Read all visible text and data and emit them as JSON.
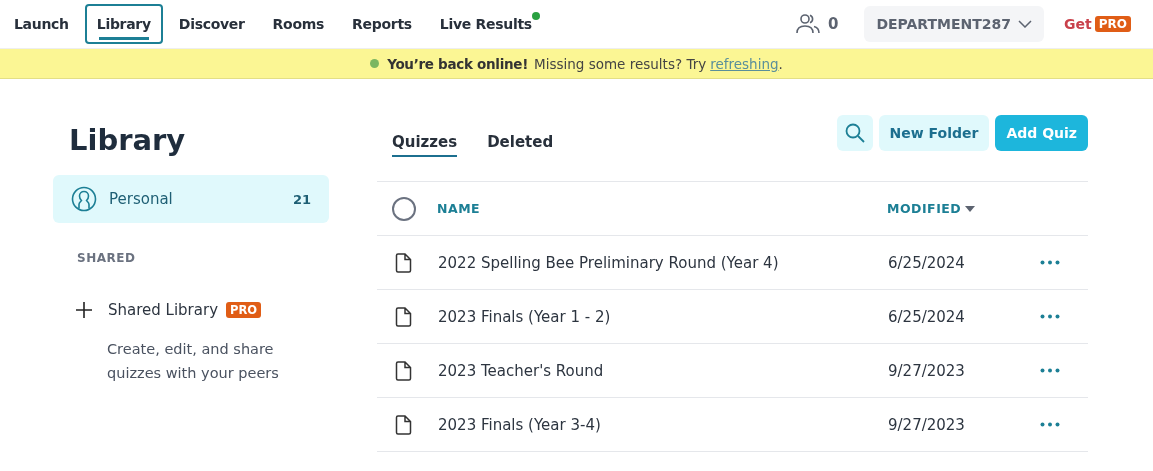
{
  "nav": {
    "items": [
      {
        "label": "Launch",
        "selected": false,
        "dot": false
      },
      {
        "label": "Library",
        "selected": true,
        "dot": false
      },
      {
        "label": "Discover",
        "selected": false,
        "dot": false
      },
      {
        "label": "Rooms",
        "selected": false,
        "dot": false
      },
      {
        "label": "Reports",
        "selected": false,
        "dot": false
      },
      {
        "label": "Live Results",
        "selected": false,
        "dot": true
      }
    ],
    "participants": "0",
    "account": "DEPARTMENT287",
    "get": "Get",
    "pro": "PRO"
  },
  "banner": {
    "bold": "You’re back online!",
    "text": "Missing some results? Try",
    "link": "refreshing",
    "end": "."
  },
  "sidebar": {
    "title": "Library",
    "personal": {
      "label": "Personal",
      "count": "21",
      "selected": true
    },
    "shared_heading": "SHARED",
    "shared_library": "Shared Library",
    "pro": "PRO",
    "description": "Create, edit, and share quizzes with your peers"
  },
  "tabs": [
    {
      "label": "Quizzes",
      "selected": true
    },
    {
      "label": "Deleted",
      "selected": false
    }
  ],
  "buttons": {
    "new_folder": "New Folder",
    "add_quiz": "Add Quiz"
  },
  "table": {
    "columns": {
      "name": "NAME",
      "modified": "MODIFIED"
    },
    "all_checked": false,
    "rows": [
      {
        "name": "2022 Spelling Bee Preliminary Round (Year 4)",
        "modified": "6/25/2024"
      },
      {
        "name": "2023 Finals (Year 1 - 2)",
        "modified": "6/25/2024"
      },
      {
        "name": "2023 Teacher's Round",
        "modified": "9/27/2023"
      },
      {
        "name": "2023 Finals (Year 3-4)",
        "modified": "9/27/2023"
      }
    ]
  }
}
